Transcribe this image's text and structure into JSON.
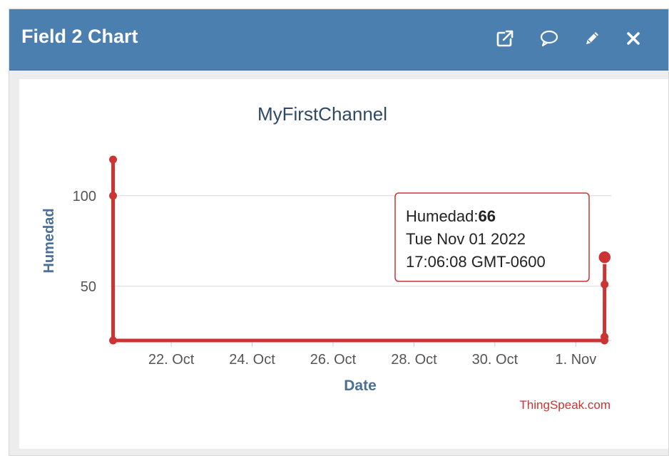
{
  "window": {
    "title": "Field 2 Chart",
    "icons": [
      "external-link-icon",
      "comment-icon",
      "pencil-icon",
      "close-icon"
    ]
  },
  "colors": {
    "header_bg": "#4a7fb0",
    "series": "#cc3333",
    "axis_title": "#4a6f99",
    "watermark": "#cc3333"
  },
  "chart_data": {
    "type": "line",
    "title": "MyFirstChannel",
    "xlabel": "Date",
    "ylabel": "Humedad",
    "ylim": [
      20,
      120
    ],
    "xlim": [
      "2022-10-20T12:00",
      "2022-11-01T21:00"
    ],
    "yticks": [
      50,
      100
    ],
    "xticks": [
      {
        "date": "2022-10-22",
        "label": "22. Oct"
      },
      {
        "date": "2022-10-24",
        "label": "24. Oct"
      },
      {
        "date": "2022-10-26",
        "label": "26. Oct"
      },
      {
        "date": "2022-10-28",
        "label": "28. Oct"
      },
      {
        "date": "2022-10-30",
        "label": "30. Oct"
      },
      {
        "date": "2022-11-01",
        "label": "1. Nov"
      }
    ],
    "grid": true,
    "series": [
      {
        "points": [
          {
            "x": "2022-10-20T13:30",
            "y": 120
          },
          {
            "x": "2022-10-20T13:30",
            "y": 100
          },
          {
            "x": "2022-10-20T13:30",
            "y": 20
          },
          {
            "x": "2022-11-01T17:00",
            "y": 20
          },
          {
            "x": "2022-11-01T17:00",
            "y": 22
          },
          {
            "x": "2022-11-01T17:03",
            "y": 51
          },
          {
            "x": "2022-11-01T17:06",
            "y": 66
          }
        ]
      }
    ],
    "tooltip": {
      "label": "Humedad:",
      "value": "66",
      "line1": "Tue Nov 01 2022",
      "line2": "17:06:08 GMT-0600"
    },
    "credit": "ThingSpeak.com"
  }
}
